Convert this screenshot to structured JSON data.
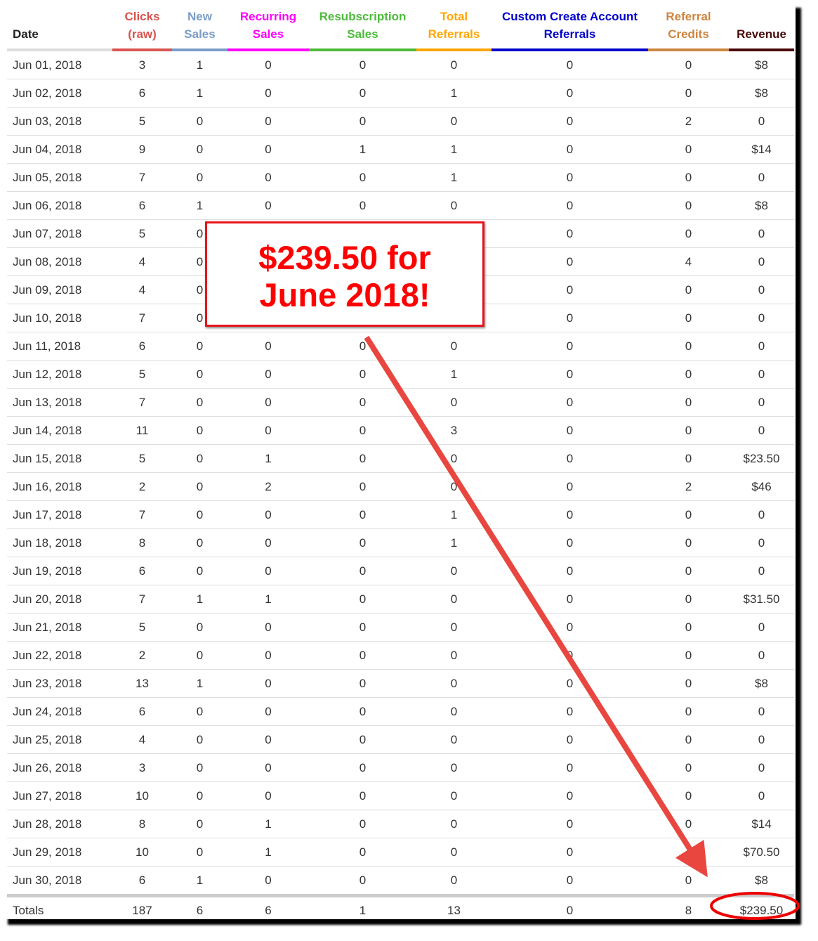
{
  "columns": [
    {
      "label": "Date",
      "color": "#222222"
    },
    {
      "label": "Clicks (raw)",
      "line1": "Clicks",
      "line2": "(raw)",
      "color": "#d9534f"
    },
    {
      "line1": "New",
      "line2": "Sales",
      "color": "#7a9cc6"
    },
    {
      "line1": "Recurring",
      "line2": "Sales",
      "color": "#ff00ff"
    },
    {
      "line1": "Resubscription",
      "line2": "Sales",
      "color": "#4cbb3a"
    },
    {
      "line1": "Total",
      "line2": "Referrals",
      "color": "#ffa500"
    },
    {
      "line1": "Custom Create Account",
      "line2": "Referrals",
      "color": "#0000cc"
    },
    {
      "line1": "Referral",
      "line2": "Credits",
      "color": "#cd853f"
    },
    {
      "line1": "",
      "line2": "Revenue",
      "color": "#4a0a0a"
    }
  ],
  "rows": [
    [
      "Jun 01, 2018",
      "3",
      "1",
      "0",
      "0",
      "0",
      "0",
      "0",
      "$8"
    ],
    [
      "Jun 02, 2018",
      "6",
      "1",
      "0",
      "0",
      "1",
      "0",
      "0",
      "$8"
    ],
    [
      "Jun 03, 2018",
      "5",
      "0",
      "0",
      "0",
      "0",
      "0",
      "2",
      "0"
    ],
    [
      "Jun 04, 2018",
      "9",
      "0",
      "0",
      "1",
      "1",
      "0",
      "0",
      "$14"
    ],
    [
      "Jun 05, 2018",
      "7",
      "0",
      "0",
      "0",
      "1",
      "0",
      "0",
      "0"
    ],
    [
      "Jun 06, 2018",
      "6",
      "1",
      "0",
      "0",
      "0",
      "0",
      "0",
      "$8"
    ],
    [
      "Jun 07, 2018",
      "5",
      "0",
      "",
      "",
      "",
      "0",
      "0",
      "0"
    ],
    [
      "Jun 08, 2018",
      "4",
      "0",
      "",
      "",
      "",
      "0",
      "4",
      "0"
    ],
    [
      "Jun 09, 2018",
      "4",
      "0",
      "",
      "",
      "",
      "0",
      "0",
      "0"
    ],
    [
      "Jun 10, 2018",
      "7",
      "0",
      "",
      "",
      "",
      "0",
      "0",
      "0"
    ],
    [
      "Jun 11, 2018",
      "6",
      "0",
      "0",
      "0",
      "0",
      "0",
      "0",
      "0"
    ],
    [
      "Jun 12, 2018",
      "5",
      "0",
      "0",
      "0",
      "1",
      "0",
      "0",
      "0"
    ],
    [
      "Jun 13, 2018",
      "7",
      "0",
      "0",
      "0",
      "0",
      "0",
      "0",
      "0"
    ],
    [
      "Jun 14, 2018",
      "11",
      "0",
      "0",
      "0",
      "3",
      "0",
      "0",
      "0"
    ],
    [
      "Jun 15, 2018",
      "5",
      "0",
      "1",
      "0",
      "0",
      "0",
      "0",
      "$23.50"
    ],
    [
      "Jun 16, 2018",
      "2",
      "0",
      "2",
      "0",
      "0",
      "0",
      "2",
      "$46"
    ],
    [
      "Jun 17, 2018",
      "7",
      "0",
      "0",
      "0",
      "1",
      "0",
      "0",
      "0"
    ],
    [
      "Jun 18, 2018",
      "8",
      "0",
      "0",
      "0",
      "1",
      "0",
      "0",
      "0"
    ],
    [
      "Jun 19, 2018",
      "6",
      "0",
      "0",
      "0",
      "0",
      "0",
      "0",
      "0"
    ],
    [
      "Jun 20, 2018",
      "7",
      "1",
      "1",
      "0",
      "0",
      "0",
      "0",
      "$31.50"
    ],
    [
      "Jun 21, 2018",
      "5",
      "0",
      "0",
      "0",
      "0",
      "0",
      "0",
      "0"
    ],
    [
      "Jun 22, 2018",
      "2",
      "0",
      "0",
      "0",
      "0",
      "0",
      "0",
      "0"
    ],
    [
      "Jun 23, 2018",
      "13",
      "1",
      "0",
      "0",
      "0",
      "0",
      "0",
      "$8"
    ],
    [
      "Jun 24, 2018",
      "6",
      "0",
      "0",
      "0",
      "0",
      "0",
      "0",
      "0"
    ],
    [
      "Jun 25, 2018",
      "4",
      "0",
      "0",
      "0",
      "0",
      "0",
      "0",
      "0"
    ],
    [
      "Jun 26, 2018",
      "3",
      "0",
      "0",
      "0",
      "0",
      "0",
      "0",
      "0"
    ],
    [
      "Jun 27, 2018",
      "10",
      "0",
      "0",
      "0",
      "0",
      "0",
      "0",
      "0"
    ],
    [
      "Jun 28, 2018",
      "8",
      "0",
      "1",
      "0",
      "0",
      "0",
      "0",
      "$14"
    ],
    [
      "Jun 29, 2018",
      "10",
      "0",
      "1",
      "0",
      "0",
      "0",
      "",
      "$70.50"
    ],
    [
      "Jun 30, 2018",
      "6",
      "1",
      "0",
      "0",
      "0",
      "0",
      "0",
      "$8"
    ]
  ],
  "totals": [
    "Totals",
    "187",
    "6",
    "6",
    "1",
    "13",
    "0",
    "8",
    "$239.50"
  ],
  "callout": {
    "line1": "$239.50 for",
    "line2": "June 2018!",
    "color": "#ff0000"
  },
  "annotation_color": "#e8463f"
}
